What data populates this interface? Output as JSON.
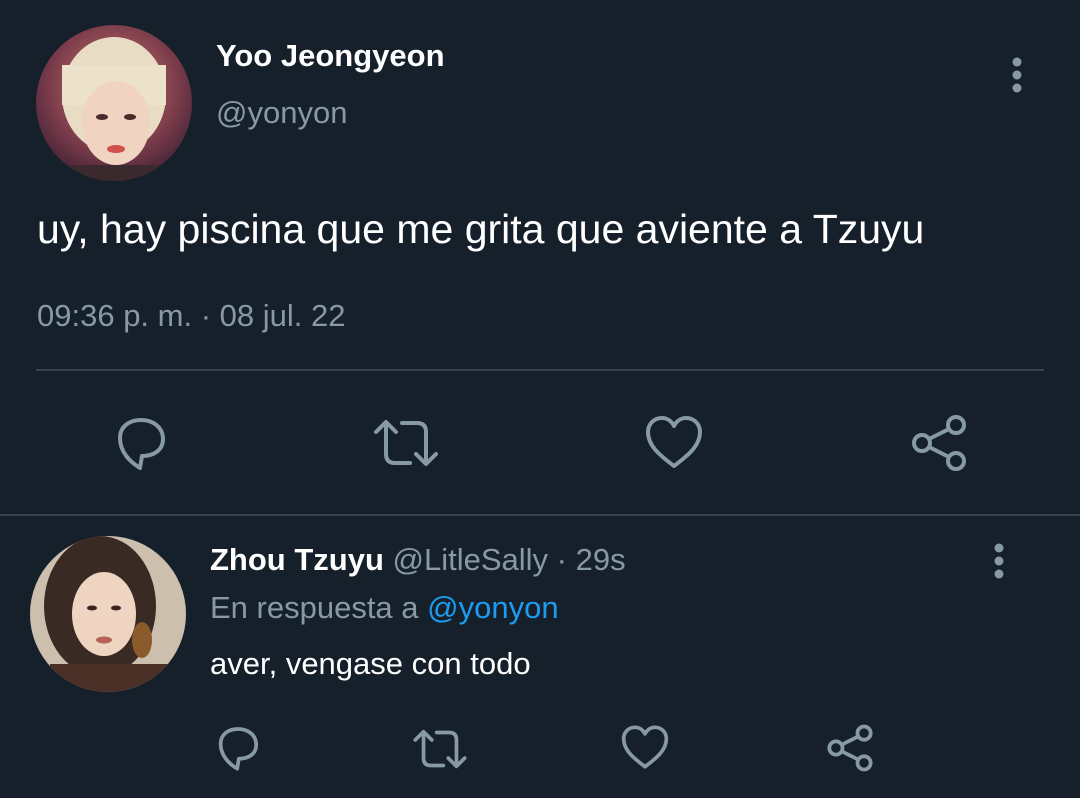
{
  "main_tweet": {
    "display_name": "Yoo Jeongyeon",
    "handle": "@yonyon",
    "text": "uy, hay piscina que me grita que aviente a Tzuyu",
    "timestamp": "09:36 p. m. · 08 jul. 22",
    "actions": [
      "reply-icon",
      "retweet-icon",
      "like-icon",
      "share-icon"
    ]
  },
  "reply": {
    "display_name": "Zhou Tzuyu",
    "handle": "@LitleSally",
    "separator": " · ",
    "age": "29s",
    "replying_prefix": "En respuesta a",
    "replying_to": "@yonyon",
    "text": "aver, vengase con todo",
    "actions": [
      "reply-icon",
      "retweet-icon",
      "like-icon",
      "share-icon"
    ]
  },
  "colors": {
    "background": "#15202b",
    "text": "#ffffff",
    "muted": "#8899a6",
    "link": "#1d9bf0",
    "divider": "#38444d"
  }
}
